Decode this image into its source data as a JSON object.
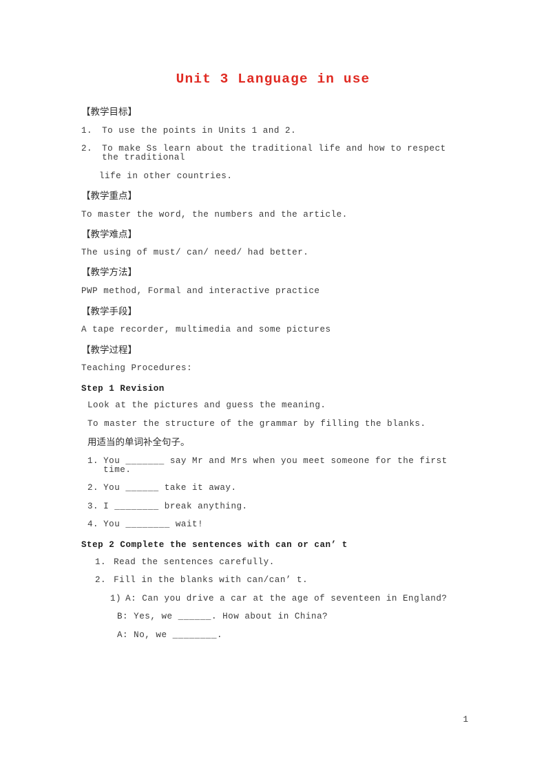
{
  "document": {
    "title": "Unit 3 Language in use",
    "title_color": "#e02a22",
    "page_number": "1"
  },
  "sections": {
    "objectives": {
      "heading": "【教学目标】",
      "items": [
        {
          "marker": "1.",
          "text": "To use the points in Units 1 and 2."
        },
        {
          "marker": "2.",
          "text": "To make Ss learn about the traditional life and how to respect the traditional"
        },
        {
          "marker": "",
          "text": "life in other countries."
        }
      ]
    },
    "key_points": {
      "heading": "【教学重点】",
      "body": "To master the word, the numbers and the article."
    },
    "difficult_points": {
      "heading": "【教学难点】",
      "body": "The using of must/ can/ need/ had better."
    },
    "methods": {
      "heading": "【教学方法】",
      "body": "PWP method, Formal and interactive practice"
    },
    "aids": {
      "heading": "【教学手段】",
      "body": "A tape recorder, multimedia and some pictures"
    },
    "procedure": {
      "heading": "【教学过程】",
      "body": "Teaching Procedures:",
      "step1": {
        "heading": "Step 1 Revision",
        "line1": "Look at the pictures and guess the meaning.",
        "line2": "To master the structure of the grammar by filling the blanks.",
        "cn_instruction": "用适当的单词补全句子。",
        "items": [
          {
            "marker": "1.",
            "text": "You _______ say Mr and Mrs when you meet someone for the first time."
          },
          {
            "marker": "2.",
            "text": "You ______ take it away."
          },
          {
            "marker": "3.",
            "text": "I ________ break anything."
          },
          {
            "marker": "4.",
            "text": "You ________ wait!"
          }
        ]
      },
      "step2": {
        "heading": "Step 2 Complete the sentences with can or can’ t",
        "items": [
          {
            "marker": "1.",
            "text": "Read the sentences carefully."
          },
          {
            "marker": "2.",
            "text": "Fill in the blanks with can/can’ t."
          }
        ],
        "dialogue": [
          {
            "marker": "1)",
            "text": "A: Can you drive a car at the age of seventeen in England?"
          },
          {
            "marker": "",
            "text": "B: Yes, we ______. How about in China?"
          },
          {
            "marker": "",
            "text": "A: No, we ________."
          }
        ]
      }
    }
  }
}
